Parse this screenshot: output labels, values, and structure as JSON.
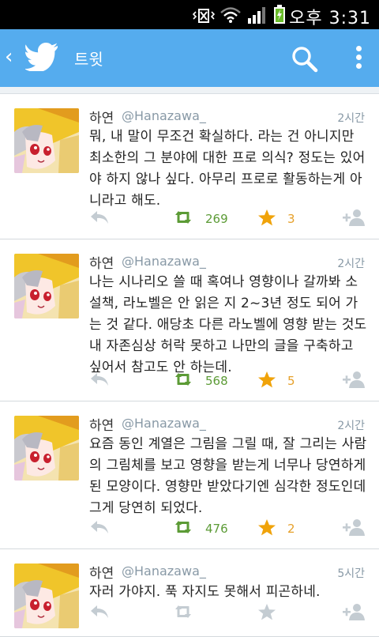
{
  "status": {
    "time": "오후 3:31"
  },
  "header": {
    "title": "트윗"
  },
  "colors": {
    "appbar": "#55acee",
    "retweet": "#5c9b36",
    "favorite": "#e6a02a"
  },
  "tweets": [
    {
      "name": "하연",
      "handle": "@Hanazawa_",
      "time": "2시간",
      "text": "뭐, 내 말이 무조건 확실하다. 라는 건 아니지만 최소한의 그 분야에 대한 프로 의식? 정도는 있어야 하지 않나 싶다. 아무리 프로로 활동하는게 아니라고 해도.",
      "retweets": "269",
      "favorites": "3"
    },
    {
      "name": "하연",
      "handle": "@Hanazawa_",
      "time": "2시간",
      "text": "나는 시나리오 쓸 때 혹여나 영향이나 갈까봐 소설책, 라노벨은 안 읽은 지 2~3년 정도 되어 가는 것 같다. 애당초 다른 라노벨에 영향 받는 것도 내 자존심상 허락 못하고 나만의 글을 구축하고 싶어서 참고도 안 하는데.",
      "retweets": "568",
      "favorites": "5"
    },
    {
      "name": "하연",
      "handle": "@Hanazawa_",
      "time": "2시간",
      "text": "요즘 동인 계열은 그림을 그릴 때, 잘 그리는 사람의 그림체를 보고 영향을 받는게 너무나 당연하게 된 모양이다. 영향만 받았다기엔 심각한 정도인데 그게 당연히 되었다.",
      "retweets": "476",
      "favorites": "2"
    },
    {
      "name": "하연",
      "handle": "@Hanazawa_",
      "time": "5시간",
      "text": "자러 가야지. 푹 자지도 못해서 피곤하네.",
      "retweets": "",
      "favorites": ""
    }
  ]
}
